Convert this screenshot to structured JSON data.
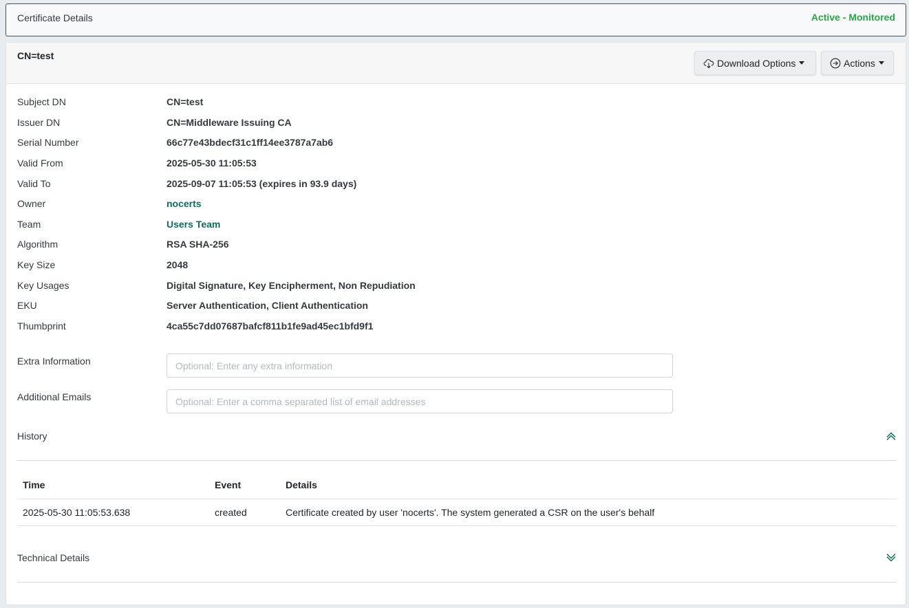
{
  "header": {
    "title": "Certificate Details",
    "status": "Active - Monitored",
    "status_color": "#28a745"
  },
  "card": {
    "title": "CN=test",
    "download_label": "Download Options",
    "actions_label": "Actions"
  },
  "fields": [
    {
      "label": "Subject DN",
      "value": "CN=test"
    },
    {
      "label": "Issuer DN",
      "value": "CN=Middleware Issuing CA"
    },
    {
      "label": "Serial Number",
      "value": "66c77e43bdecf31c1ff14ee3787a7ab6"
    },
    {
      "label": "Valid From",
      "value": "2025-05-30 11:05:53"
    },
    {
      "label": "Valid To",
      "value": "2025-09-07 11:05:53 (expires in 93.9 days)"
    },
    {
      "label": "Owner",
      "value": "nocerts"
    },
    {
      "label": "Team",
      "value": "Users Team"
    },
    {
      "label": "Algorithm",
      "value": "RSA SHA-256"
    },
    {
      "label": "Key Size",
      "value": "2048"
    },
    {
      "label": "Key Usages",
      "value": "Digital Signature, Key Encipherment, Non Repudiation"
    },
    {
      "label": "EKU",
      "value": "Server Authentication, Client Authentication"
    },
    {
      "label": "Thumbprint",
      "value": "4ca55c7dd07687bafcf811b1fe9ad45ec1bfd9f1"
    }
  ],
  "extra_info": {
    "label": "Extra Information",
    "placeholder": "Optional: Enter any extra information",
    "value": ""
  },
  "additional_emails": {
    "label": "Additional Emails",
    "placeholder": "Optional: Enter a comma separated list of email addresses",
    "value": ""
  },
  "history": {
    "title": "History",
    "columns": [
      "Time",
      "Event",
      "Details"
    ],
    "rows": [
      {
        "time": "2025-05-30 11:05:53.638",
        "event": "created",
        "details": "Certificate created by user 'nocerts'. The system generated a CSR on the user's behalf"
      }
    ]
  },
  "technical": {
    "title": "Technical Details"
  },
  "colors": {
    "link": "#0e6e5c",
    "chevron": "#0e6e5c"
  }
}
